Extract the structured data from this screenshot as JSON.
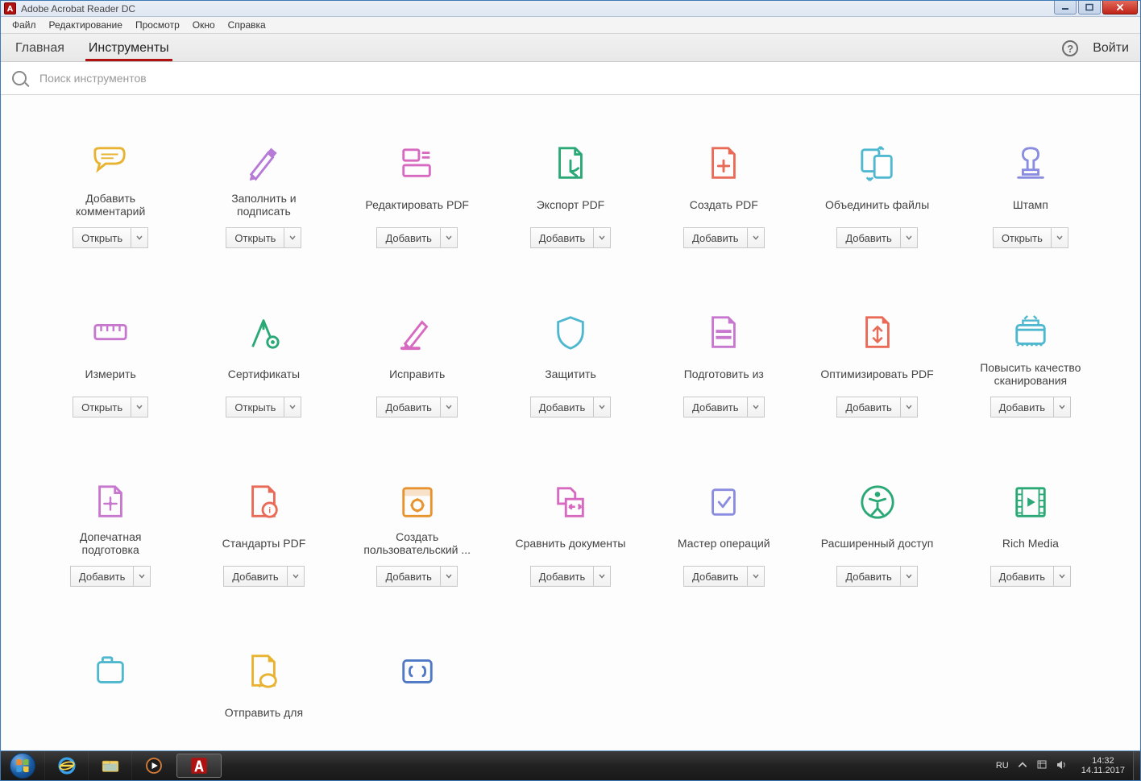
{
  "titlebar": {
    "app_name": "Adobe Acrobat Reader DC"
  },
  "menubar": [
    "Файл",
    "Редактирование",
    "Просмотр",
    "Окно",
    "Справка"
  ],
  "tabs": {
    "left": [
      "Главная",
      "Инструменты"
    ],
    "active": "Инструменты",
    "help": "?",
    "login": "Войти"
  },
  "search": {
    "placeholder": "Поиск инструментов"
  },
  "buttons": {
    "open": "Открыть",
    "add": "Добавить"
  },
  "tools": [
    {
      "id": "comment",
      "label": "Добавить комментарий",
      "action": "open",
      "icon": "comment",
      "color": "#e7b331"
    },
    {
      "id": "fill-sign",
      "label": "Заполнить и подписать",
      "action": "open",
      "icon": "pen",
      "color": "#b57bd6"
    },
    {
      "id": "edit-pdf",
      "label": "Редактировать PDF",
      "action": "add",
      "icon": "editpdf",
      "color": "#d769c0"
    },
    {
      "id": "export-pdf",
      "label": "Экспорт PDF",
      "action": "add",
      "icon": "export",
      "color": "#2aa876"
    },
    {
      "id": "create-pdf",
      "label": "Создать PDF",
      "action": "add",
      "icon": "create",
      "color": "#e96a57"
    },
    {
      "id": "combine",
      "label": "Объединить файлы",
      "action": "add",
      "icon": "combine",
      "color": "#4fb8cf"
    },
    {
      "id": "stamp",
      "label": "Штамп",
      "action": "open",
      "icon": "stamp",
      "color": "#8a8ce0"
    },
    {
      "id": "measure",
      "label": "Измерить",
      "action": "open",
      "icon": "measure",
      "color": "#c877cf"
    },
    {
      "id": "certs",
      "label": "Сертификаты",
      "action": "open",
      "icon": "cert",
      "color": "#2aa876"
    },
    {
      "id": "redact",
      "label": "Исправить",
      "action": "add",
      "icon": "redact",
      "color": "#d769c0"
    },
    {
      "id": "protect",
      "label": "Защитить",
      "action": "add",
      "icon": "shield",
      "color": "#4fb8cf"
    },
    {
      "id": "prepare",
      "label": "Подготовить из",
      "action": "add",
      "icon": "prepare",
      "color": "#c877cf"
    },
    {
      "id": "optimize",
      "label": "Оптимизировать PDF",
      "action": "add",
      "icon": "optimize",
      "color": "#e96a57"
    },
    {
      "id": "scan-enh",
      "label": "Повысить качество сканирования",
      "action": "add",
      "icon": "scan",
      "color": "#4fb8cf"
    },
    {
      "id": "preflight",
      "label": "Допечатная подготовка",
      "action": "add",
      "icon": "preflight",
      "color": "#c877cf"
    },
    {
      "id": "standards",
      "label": "Стандарты PDF",
      "action": "add",
      "icon": "standards",
      "color": "#e96a57"
    },
    {
      "id": "custom-tool",
      "label": "Создать пользовательский ...",
      "action": "add",
      "icon": "custom",
      "color": "#e7932e"
    },
    {
      "id": "compare",
      "label": "Сравнить документы",
      "action": "add",
      "icon": "compare",
      "color": "#d769c0"
    },
    {
      "id": "action-wiz",
      "label": "Мастер операций",
      "action": "add",
      "icon": "wizard",
      "color": "#8a8ce0"
    },
    {
      "id": "accessibility",
      "label": "Расширенный доступ",
      "action": "add",
      "icon": "access",
      "color": "#2aa876"
    },
    {
      "id": "rich-media",
      "label": "Rich Media",
      "action": "add",
      "icon": "rich",
      "color": "#2aa876"
    },
    {
      "id": "index",
      "label": " ",
      "action": "",
      "icon": "index",
      "color": "#4fb8cf"
    },
    {
      "id": "send",
      "label": "Отправить для",
      "action": "",
      "icon": "send",
      "color": "#e7b331"
    },
    {
      "id": "javascript",
      "label": " ",
      "action": "",
      "icon": "js",
      "color": "#4f79c4"
    }
  ],
  "systray": {
    "lang": "RU",
    "time": "14:32",
    "date": "14.11.2017"
  }
}
